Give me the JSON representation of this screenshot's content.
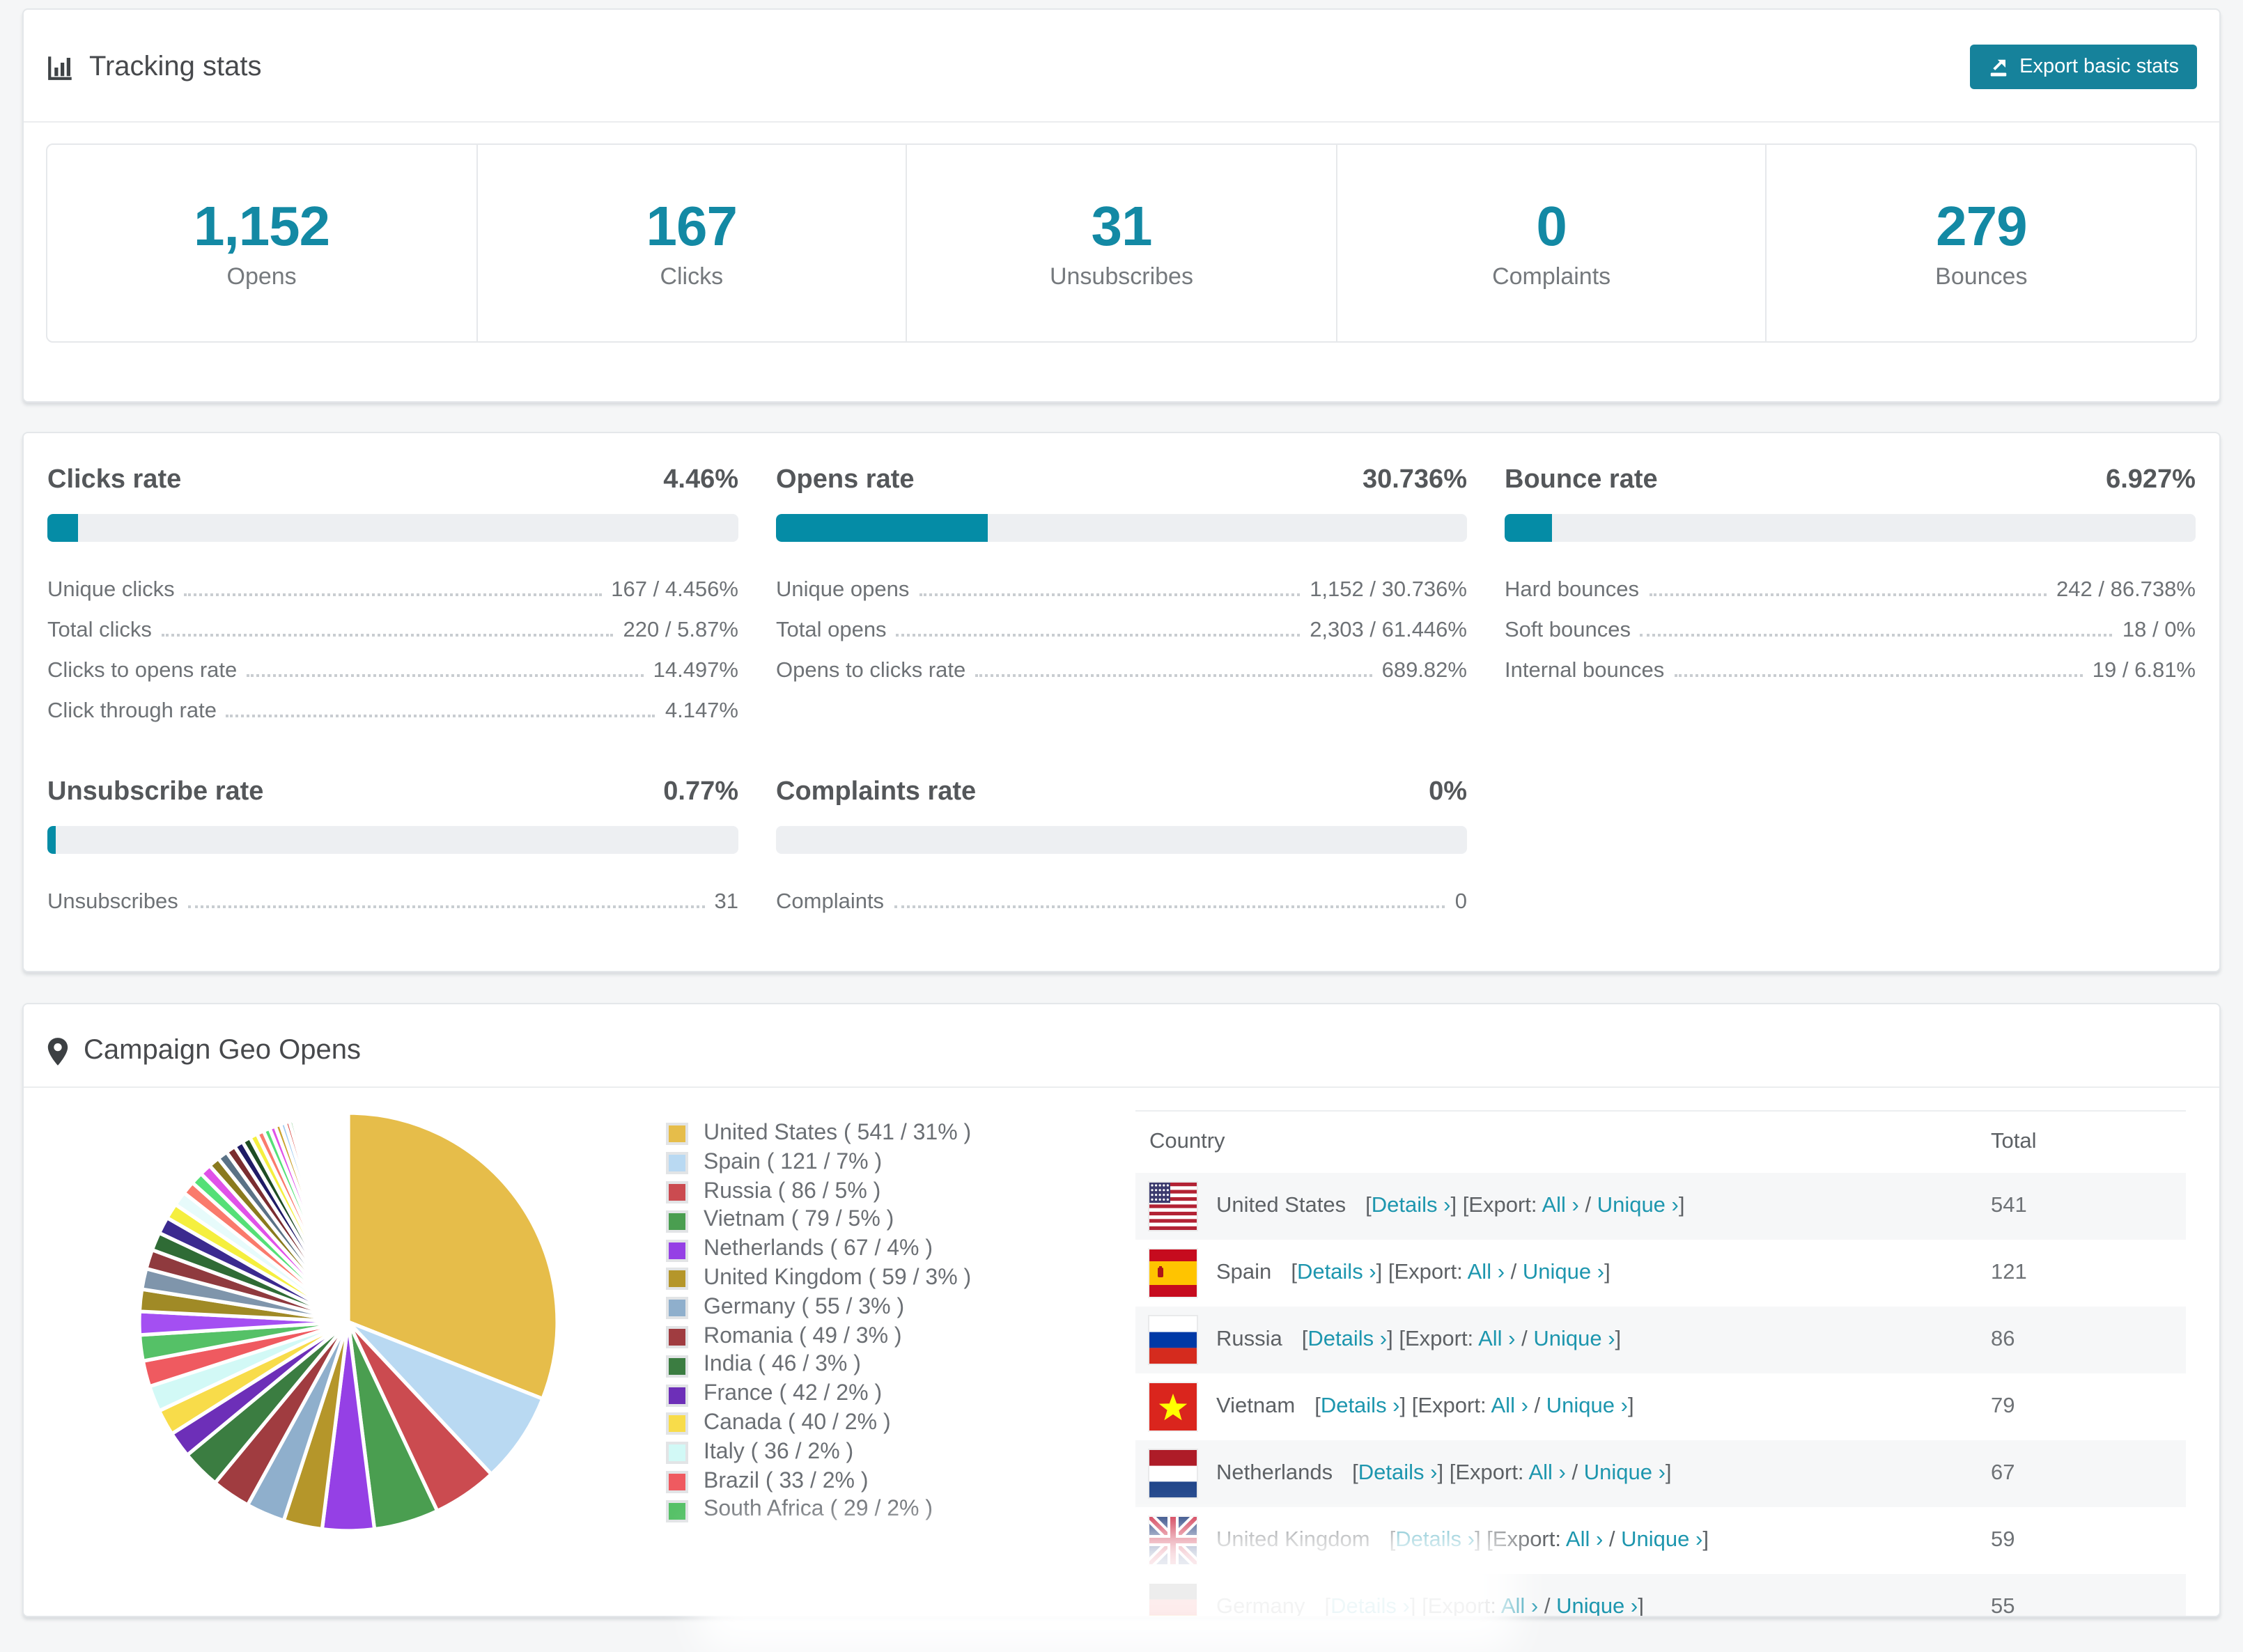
{
  "colors": {
    "accent_button": "#16829b",
    "accent_number": "#1389a4",
    "accent_link": "#1d96ae",
    "progress_fill": "#058ca6",
    "progress_track": "#edeff2"
  },
  "tracking": {
    "title": "Tracking stats",
    "export_button": "Export basic stats",
    "stats": [
      {
        "value": "1,152",
        "label": "Opens"
      },
      {
        "value": "167",
        "label": "Clicks"
      },
      {
        "value": "31",
        "label": "Unsubscribes"
      },
      {
        "value": "0",
        "label": "Complaints"
      },
      {
        "value": "279",
        "label": "Bounces"
      }
    ]
  },
  "rates": [
    {
      "title": "Clicks rate",
      "value": "4.46%",
      "progress_pct": 4.46,
      "rows": [
        [
          "Unique clicks",
          "167 / 4.456%"
        ],
        [
          "Total clicks",
          "220 / 5.87%"
        ],
        [
          "Clicks to opens rate",
          "14.497%"
        ],
        [
          "Click through rate",
          "4.147%"
        ]
      ]
    },
    {
      "title": "Opens rate",
      "value": "30.736%",
      "progress_pct": 30.736,
      "rows": [
        [
          "Unique opens",
          "1,152 / 30.736%"
        ],
        [
          "Total opens",
          "2,303 / 61.446%"
        ],
        [
          "Opens to clicks rate",
          "689.82%"
        ]
      ]
    },
    {
      "title": "Bounce rate",
      "value": "6.927%",
      "progress_pct": 6.927,
      "rows": [
        [
          "Hard bounces",
          "242 / 86.738%"
        ],
        [
          "Soft bounces",
          "18 / 0%"
        ],
        [
          "Internal bounces",
          "19 / 6.81%"
        ]
      ]
    },
    {
      "title": "Unsubscribe rate",
      "value": "0.77%",
      "progress_pct": 0.77,
      "rows": [
        [
          "Unsubscribes",
          "31"
        ]
      ]
    },
    {
      "title": "Complaints rate",
      "value": "0%",
      "progress_pct": 0,
      "rows": [
        [
          "Complaints",
          "0"
        ]
      ]
    }
  ],
  "geo": {
    "title": "Campaign Geo Opens",
    "table_headers": {
      "country": "Country",
      "total": "Total"
    },
    "link_parts": {
      "open_bracket": "[",
      "close_bracket": "]",
      "details": "Details ›",
      "export_label": "[Export:",
      "all": "All ›",
      "slash": "/",
      "unique": "Unique ›"
    },
    "rows": [
      {
        "country": "United States",
        "flag": "us",
        "total": "541"
      },
      {
        "country": "Spain",
        "flag": "es",
        "total": "121"
      },
      {
        "country": "Russia",
        "flag": "ru",
        "total": "86"
      },
      {
        "country": "Vietnam",
        "flag": "vn",
        "total": "79"
      },
      {
        "country": "Netherlands",
        "flag": "nl",
        "total": "67"
      },
      {
        "country": "United Kingdom",
        "flag": "gb",
        "total": "59"
      },
      {
        "country": "Germany",
        "flag": "de",
        "total": "55"
      }
    ]
  },
  "chart_data": {
    "type": "pie",
    "title": "Campaign Geo Opens",
    "legend_position": "right",
    "start_angle_deg": 0,
    "direction": "clockwise",
    "series": [
      {
        "name": "United States",
        "value": 541,
        "pct": 31,
        "color": "#e6bd4a"
      },
      {
        "name": "Spain",
        "value": 121,
        "pct": 7,
        "color": "#b9d9f2"
      },
      {
        "name": "Russia",
        "value": 86,
        "pct": 5,
        "color": "#cb4b50"
      },
      {
        "name": "Vietnam",
        "value": 79,
        "pct": 5,
        "color": "#4a9e50"
      },
      {
        "name": "Netherlands",
        "value": 67,
        "pct": 4,
        "color": "#9540e5"
      },
      {
        "name": "United Kingdom",
        "value": 59,
        "pct": 3,
        "color": "#b5962a"
      },
      {
        "name": "Germany",
        "value": 55,
        "pct": 3,
        "color": "#8fafcc"
      },
      {
        "name": "Romania",
        "value": 49,
        "pct": 3,
        "color": "#a03c40"
      },
      {
        "name": "India",
        "value": 46,
        "pct": 3,
        "color": "#3b7d41"
      },
      {
        "name": "France",
        "value": 42,
        "pct": 2,
        "color": "#6d2fb8"
      },
      {
        "name": "Canada",
        "value": 40,
        "pct": 2,
        "color": "#f8dc4a"
      },
      {
        "name": "Italy",
        "value": 36,
        "pct": 2,
        "color": "#d2f9f6"
      },
      {
        "name": "Brazil",
        "value": 33,
        "pct": 2,
        "color": "#ef5a60"
      },
      {
        "name": "South Africa",
        "value": 29,
        "pct": 2,
        "color": "#55c167"
      }
    ],
    "others": [
      {
        "pct": 1.8,
        "color": "#a44ff2"
      },
      {
        "pct": 1.7,
        "color": "#a08a26"
      },
      {
        "pct": 1.6,
        "color": "#7f95ab"
      },
      {
        "pct": 1.5,
        "color": "#8f3a3e"
      },
      {
        "pct": 1.4,
        "color": "#2f6b35"
      },
      {
        "pct": 1.3,
        "color": "#3b2a8f"
      },
      {
        "pct": 1.2,
        "color": "#f5ef3f"
      },
      {
        "pct": 1.1,
        "color": "#e7fbfb"
      },
      {
        "pct": 1.0,
        "color": "#fa7a6c"
      },
      {
        "pct": 0.95,
        "color": "#55e077"
      },
      {
        "pct": 0.9,
        "color": "#e052e8"
      },
      {
        "pct": 0.85,
        "color": "#8a7a1e"
      },
      {
        "pct": 0.8,
        "color": "#5a7286"
      },
      {
        "pct": 0.75,
        "color": "#7a2d30"
      },
      {
        "pct": 0.7,
        "color": "#1f1b66"
      },
      {
        "pct": 0.65,
        "color": "#1e4d24"
      },
      {
        "pct": 0.6,
        "color": "#f5ef3f"
      },
      {
        "pct": 0.55,
        "color": "#fa7a6c"
      },
      {
        "pct": 0.5,
        "color": "#55e077"
      },
      {
        "pct": 0.46,
        "color": "#e052e8"
      },
      {
        "pct": 0.42,
        "color": "#caa32e"
      },
      {
        "pct": 0.38,
        "color": "#9ecbf2"
      },
      {
        "pct": 0.34,
        "color": "#d9453f"
      },
      {
        "pct": 0.3,
        "color": "#3fae4c"
      },
      {
        "pct": 0.27,
        "color": "#7a3bd4"
      },
      {
        "pct": 0.24,
        "color": "#a08a26"
      },
      {
        "pct": 0.21,
        "color": "#f7a8c0"
      },
      {
        "pct": 0.18,
        "color": "#9ecbf2"
      },
      {
        "pct": 0.16,
        "color": "#d9453f"
      },
      {
        "pct": 0.14,
        "color": "#3fae4c"
      },
      {
        "pct": 0.12,
        "color": "#7a3bd4"
      },
      {
        "pct": 0.1,
        "color": "#caa32e"
      },
      {
        "pct": 0.09,
        "color": "#e052e8"
      },
      {
        "pct": 0.08,
        "color": "#55e077"
      },
      {
        "pct": 0.07,
        "color": "#fa7a6c"
      },
      {
        "pct": 0.06,
        "color": "#f5ef3f"
      },
      {
        "pct": 0.05,
        "color": "#8f3a3e"
      },
      {
        "pct": 0.05,
        "color": "#7f95ab"
      },
      {
        "pct": 0.04,
        "color": "#a08a26"
      },
      {
        "pct": 0.04,
        "color": "#a44ff2"
      }
    ],
    "legend_format": "{name} ( {value} / {pct}% )"
  }
}
